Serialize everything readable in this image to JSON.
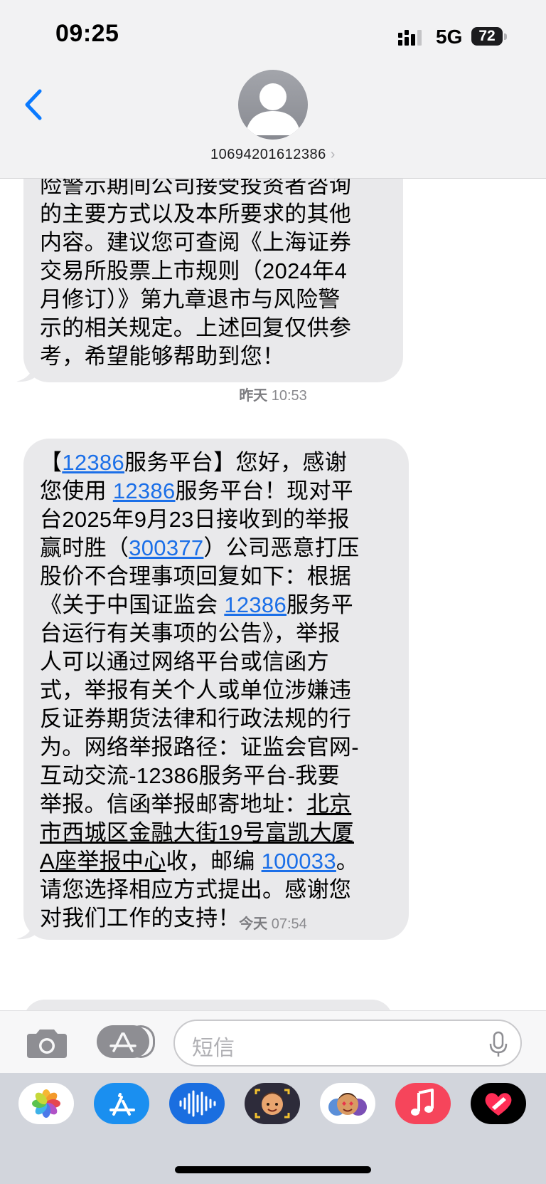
{
  "status_bar": {
    "time": "09:25",
    "network": "5G",
    "battery": "72"
  },
  "header": {
    "contact": "10694201612386",
    "chevron": "›"
  },
  "thread": {
    "message1": "险警示期间公司接受投资者咨询\n的主要方式以及本所要求的其他\n内容。建议您可查阅《上海证券\n交易所股票上市规则（2024年4\n月修订）》第九章退市与风险警\n示的相关规定。上述回复仅供参\n考，希望能够帮助到您！",
    "timestamp1": {
      "day": "昨天",
      "time": "10:53"
    },
    "message2": {
      "s1": "【",
      "l1": "12386",
      "s2": "服务平台】您好，感谢\n您使用 ",
      "l2": "12386",
      "s3": "服务平台！现对平\n台2025年9月23日接收到的举报\n赢时胜（",
      "l3": "300377",
      "s4": "）公司恶意打压\n股价不合理事项回复如下：根据\n《关于中国证监会 ",
      "l4": "12386",
      "s5": "服务平\n台运行有关事项的公告》，举报\n人可以通过网络平台或信函方\n式，举报有关个人或单位涉嫌违\n反证券期货法律和行政法规的行\n为。网络举报路径：证监会官网-\n互动交流-12386服务平台-我要\n举报。信函举报邮寄地址：",
      "addr": "北京\n市西城区金融大街19号富凯大厦\nA座举报中心",
      "s6": "收，邮编 ",
      "l5": "100033",
      "s7": "。\n请您选择相应方式提出。感谢您\n对我们工作的支持！"
    },
    "timestamp2": {
      "day": "今天",
      "time": "07:54"
    }
  },
  "input": {
    "placeholder": "短信"
  },
  "apps": [
    "photos-icon",
    "app-store-icon",
    "voice-memo-icon",
    "memoji-icon",
    "animoji-icon",
    "music-icon",
    "digital-touch-icon"
  ],
  "colors": {
    "link": "#1b6fe8",
    "bubble": "#e9e9eb",
    "ios_blue": "#0a7aff",
    "music_red": "#f6455b"
  }
}
